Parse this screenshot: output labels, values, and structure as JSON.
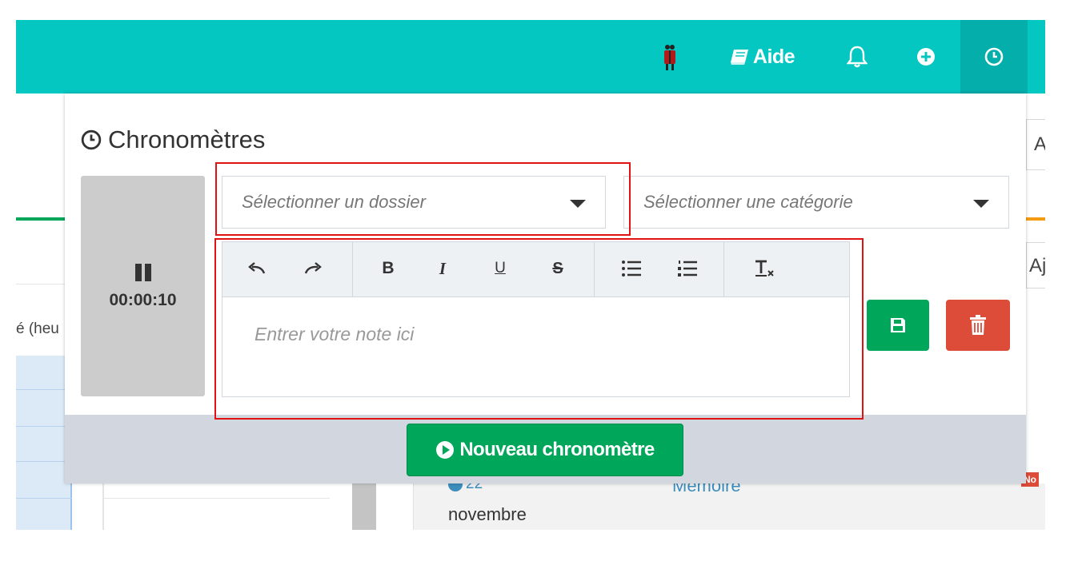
{
  "topbar": {
    "help_label": "Aide",
    "colors": {
      "bar": "#05c7c2",
      "active": "#04aeaa"
    },
    "icons": [
      "figure-icon",
      "book-icon",
      "bell-icon",
      "plus-circle-icon",
      "clock-icon"
    ]
  },
  "background": {
    "left_text": "é (heu",
    "right_text_1": "A",
    "right_text_2": "Aj",
    "list_date": "22",
    "list_month": "novembre",
    "list_title": "Mémoire",
    "badge": "No"
  },
  "popup": {
    "title": "Chronomètres",
    "timer": {
      "time": "00:00:10",
      "state_icon": "pause-icon"
    },
    "dossier_placeholder": "Sélectionner un dossier",
    "categorie_placeholder": "Sélectionner une catégorie",
    "editor": {
      "toolbar": [
        "undo-icon",
        "redo-icon",
        "bold-icon",
        "italic-icon",
        "underline-icon",
        "strike-icon",
        "bullet-list-icon",
        "ordered-list-icon",
        "clear-format-icon"
      ],
      "bold_label": "B",
      "italic_label": "I",
      "underline_label": "U",
      "strike_label": "S",
      "placeholder": "Entrer votre note ici"
    },
    "new_timer_label": "Nouveau chronomètre",
    "colors": {
      "save": "#00a65a",
      "delete": "#dd4b39",
      "timer_box": "#cccccc",
      "highlight": "#e01212"
    }
  }
}
